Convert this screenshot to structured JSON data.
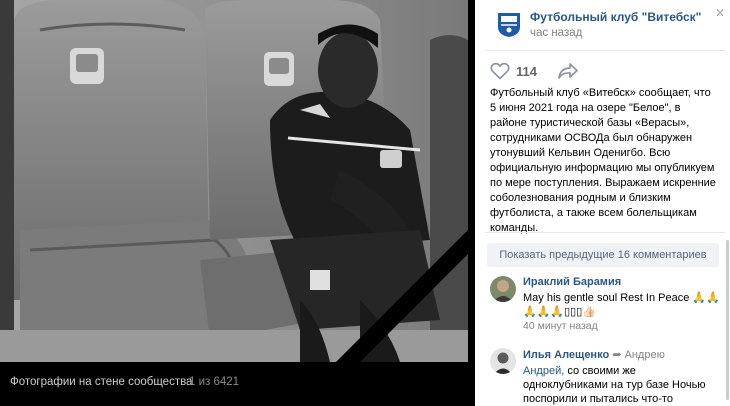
{
  "viewer": {
    "caption": "Фотографии на стене сообщества",
    "counter": "1 из 6421"
  },
  "post": {
    "group_name": "Футбольный клуб \"Витебск\"",
    "time": "час назад",
    "likes": "114",
    "text": "Футбольный клуб «Витебск» сообщает, что 5 июня 2021 года на озере \"Белое\", в районе туристической базы «Верасы», сотрудниками ОСВОДа был обнаружен утонувший Кельвин Оденигбо. Всю официальную информацию мы опубликуем по мере поступления. Выражаем искренние соболезнования родным и близким футболиста, а также всем болельщикам команды."
  },
  "comments": {
    "show_previous": "Показать предыдущие 16 комментариев",
    "items": [
      {
        "author": "Ираклий Барамия",
        "text": "May his gentle soul Rest In Peace 🙏🙏 🙏🙏🙏▯▯▯👍🏻",
        "time": "40 минут назад"
      },
      {
        "author": "Илья Алещенко",
        "reply_to": "Андрею",
        "mention": "Андрей,",
        "text": " со своими же одноклубниками на тур базе Ночью поспорили и пытались что-то"
      }
    ]
  },
  "colors": {
    "link": "#2a5885",
    "meta": "#828282",
    "panel_bg": "#ffffff",
    "viewer_bg": "#000000"
  },
  "icons": [
    "group-logo-icon",
    "close-icon",
    "heart-icon",
    "share-icon",
    "reply-arrow-icon"
  ]
}
